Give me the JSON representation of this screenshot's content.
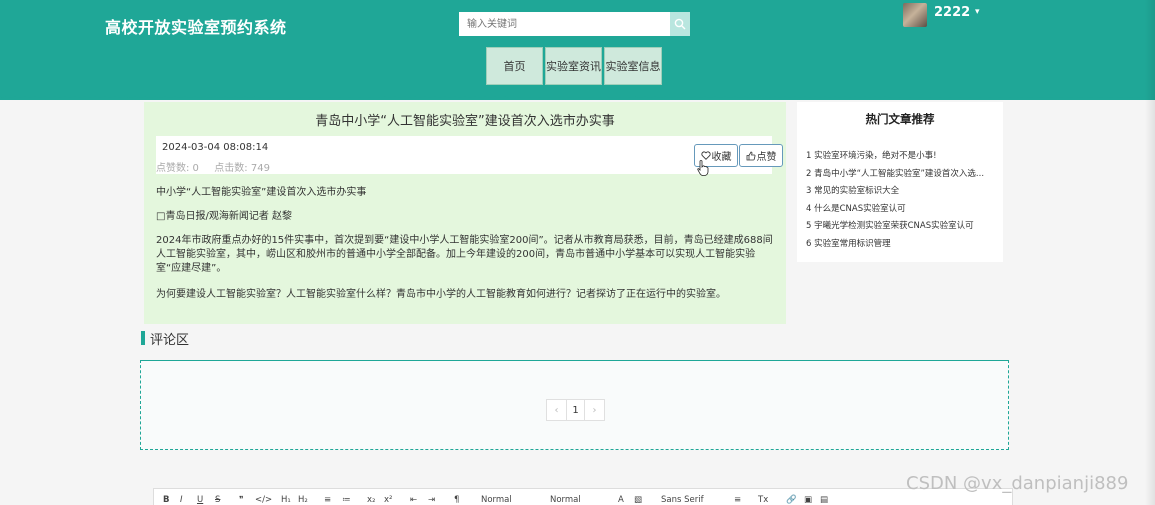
{
  "header": {
    "site_title": "高校开放实验室预约系统",
    "search_placeholder": "输入关键词",
    "username": "2222",
    "user_caret": "▾"
  },
  "nav": {
    "items": [
      "首页",
      "实验室资讯",
      "实验室信息"
    ]
  },
  "article": {
    "title": "青岛中小学“人工智能实验室”建设首次入选市办实事",
    "date": "2024-03-04 08:08:14",
    "likes_label": "点赞数: 0",
    "clicks_label": "点击数: 749",
    "favorite_label": "收藏",
    "like_label": "点赞",
    "paragraphs": [
      "中小学“人工智能实验室”建设首次入选市办实事",
      "□青岛日报/观海新闻记者 赵黎",
      "2024年市政府重点办好的15件实事中，首次提到要“建设中小学人工智能实验室200间”。记者从市教育局获悉，目前，青岛已经建成688间人工智能实验室，其中，崂山区和胶州市的普通中小学全部配备。加上今年建设的200间，青岛市普通中小学基本可以实现人工智能实验室“应建尽建”。",
      "为何要建设人工智能实验室？人工智能实验室什么样？青岛市中小学的人工智能教育如何进行？记者探访了正在运行中的实验室。"
    ]
  },
  "hot": {
    "title": "热门文章推荐",
    "items": [
      "1  实验室环境污染，绝对不是小事!",
      "2  青岛中小学“人工智能实验室”建设首次入选...",
      "3  常见的实验室标识大全",
      "4  什么是CNAS实验室认可",
      "5  宇曦光学检测实验室荣获CNAS实验室认可",
      "6  实验室常用标识管理"
    ]
  },
  "comments": {
    "title": "评论区",
    "pager": {
      "prev": "‹",
      "current": "1",
      "next": "›"
    }
  },
  "editor": {
    "bold": "B",
    "italic": "I",
    "underline": "U",
    "strike": "S",
    "quote": "❞",
    "code": "</>",
    "h1": "H₁",
    "h2": "H₂",
    "ol": "≡",
    "ul": "≔",
    "sub": "x₂",
    "sup": "x²",
    "outdent": "⇤",
    "indent": "⇥",
    "rtl": "¶",
    "size": "Normal",
    "header": "Normal",
    "color": "A",
    "background": "▧",
    "font": "Sans Serif",
    "align": "≡",
    "clean": "Tx",
    "link": "🔗",
    "image": "▣",
    "video": "▤"
  },
  "watermark": "CSDN @vx_danpianji889",
  "colors": {
    "header": "#1fa797",
    "nav_bg": "#cfe9dc",
    "article_bg": "#e4f7dd",
    "accent": "#1fa797"
  }
}
